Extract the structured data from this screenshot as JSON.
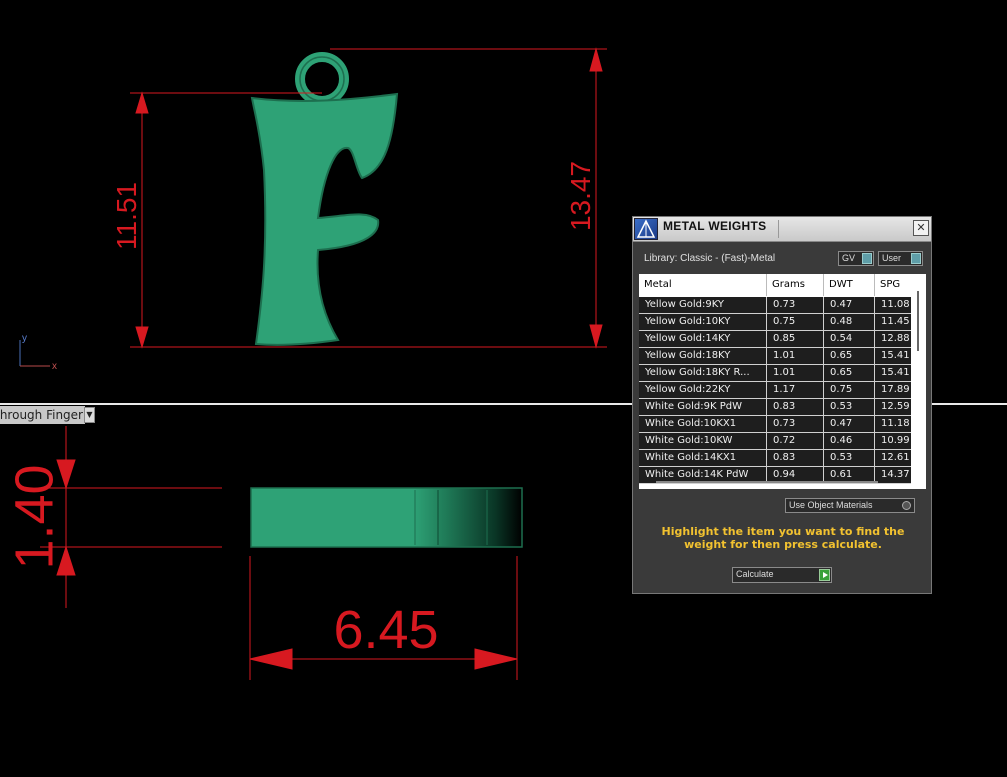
{
  "viewport": {
    "view_label": "hrough Finger",
    "axis_y": "y",
    "axis_x": "x",
    "dimensions": {
      "front_height": "11.51",
      "total_height": "13.47",
      "thickness": "1.40",
      "width": "6.45"
    },
    "colors": {
      "dimension": "#d71920",
      "model": "#2ea276",
      "background": "#000000"
    }
  },
  "metal_weights": {
    "title": "METAL WEIGHTS",
    "close_icon": "close-icon",
    "library_label": "Library: Classic - (Fast)-Metal",
    "gv_label": "GV",
    "user_label": "User",
    "columns": [
      "Metal",
      "Grams",
      "DWT",
      "SPG"
    ],
    "rows": [
      [
        "Yellow Gold:9KY",
        "0.73",
        "0.47",
        "11.08"
      ],
      [
        "Yellow Gold:10KY",
        "0.75",
        "0.48",
        "11.45"
      ],
      [
        "Yellow Gold:14KY",
        "0.85",
        "0.54",
        "12.88"
      ],
      [
        "Yellow Gold:18KY",
        "1.01",
        "0.65",
        "15.41"
      ],
      [
        "Yellow Gold:18KY R...",
        "1.01",
        "0.65",
        "15.41"
      ],
      [
        "Yellow Gold:22KY",
        "1.17",
        "0.75",
        "17.89"
      ],
      [
        "White Gold:9K PdW",
        "0.83",
        "0.53",
        "12.59"
      ],
      [
        "White Gold:10KX1",
        "0.73",
        "0.47",
        "11.18"
      ],
      [
        "White Gold:10KW",
        "0.72",
        "0.46",
        "10.99"
      ],
      [
        "White Gold:14KX1",
        "0.83",
        "0.53",
        "12.61"
      ],
      [
        "White Gold:14K PdW",
        "0.94",
        "0.61",
        "14.37"
      ]
    ],
    "use_object_materials": "Use Object Materials",
    "hint": "Highlight the item you want to find the weight for then press calculate.",
    "calculate_label": "Calculate",
    "hint_color": "#f2c230"
  }
}
